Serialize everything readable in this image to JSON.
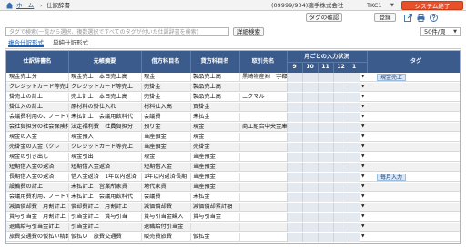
{
  "breadcrumb": {
    "home": "ホーム",
    "separator": "›",
    "current": "仕訳辞書"
  },
  "user_info": "(09999/904)糖手株式会社",
  "company_selector": {
    "label": "TKC1",
    "caret": "▼"
  },
  "exit_button": "システム終了",
  "toolbar": {
    "tag_confirm": "タグの確認",
    "register": "登録"
  },
  "icons": [
    "export-icon",
    "print-icon",
    "help-icon",
    "home-icon"
  ],
  "search": {
    "placeholder": "タグで検索(一覧から選択、複数選択ですべてのタグが付いた仕訳辞書を検索)",
    "detail_button": "詳細検索"
  },
  "per_page": {
    "value": "50件/頁",
    "caret": "▼"
  },
  "tabs": [
    {
      "label": "複合仕訳形式",
      "active": true
    },
    {
      "label": "単純仕訳形式",
      "active": false
    }
  ],
  "table": {
    "headers": {
      "name": "仕訳辞書名",
      "summary": "元帳摘要",
      "debit": "借方科目名",
      "credit": "貸方科目名",
      "partner": "取引先名",
      "monthly_group": "月ごとの入力状況",
      "months": [
        "9",
        "10",
        "11",
        "12",
        "1"
      ],
      "tag": "タグ"
    },
    "rows": [
      {
        "name": "現金売上分",
        "summary": "現金売上　本日売上高",
        "debit": "現金",
        "credit": "製品売上高",
        "partner": "黒崎物産㈱　宇都宮",
        "tag": "現金売上"
      },
      {
        "name": "クレジットカード等売上",
        "summary": "クレジットカード等売上",
        "debit": "売掛金",
        "credit": "製品売上高",
        "partner": "",
        "tag": ""
      },
      {
        "name": "掛売上の計上",
        "summary": "売上計上　本日売上高",
        "debit": "売掛金",
        "credit": "製品売上高",
        "partner": "ニクマル",
        "tag": ""
      },
      {
        "name": "掛仕入の計上",
        "summary": "原材料の掛仕入れ",
        "debit": "材料仕入高",
        "credit": "買掛金",
        "partner": "",
        "tag": ""
      },
      {
        "name": "会議費利用の、ノートで",
        "summary": "未払計上　会議用飲料代",
        "debit": "会議費",
        "credit": "未払金",
        "partner": "",
        "tag": ""
      },
      {
        "name": "会社負担分の社会保険料",
        "summary": "法定福利費　社員負担分",
        "debit": "預り金",
        "credit": "現金",
        "partner": "商工組合中央金庫",
        "tag": ""
      },
      {
        "name": "現金の入金",
        "summary": "現金預入",
        "debit": "当座預金",
        "credit": "現金",
        "partner": "",
        "tag": ""
      },
      {
        "name": "売掛金の入金（クレ",
        "summary": "クレジットカード等売上",
        "debit": "当座預金",
        "credit": "売掛金",
        "partner": "",
        "tag": ""
      },
      {
        "name": "現金の引き出し",
        "summary": "現金引出",
        "debit": "現金",
        "credit": "当座預金",
        "partner": "",
        "tag": ""
      },
      {
        "name": "短期借入金の返済",
        "summary": "短期借入金返済",
        "debit": "短期借入金",
        "credit": "当座預金",
        "partner": "",
        "tag": ""
      },
      {
        "name": "長期借入金の返済",
        "summary": "借入金返済　1年以内返済",
        "debit": "1年以内返済長期",
        "credit": "当座預金",
        "partner": "",
        "tag": "毎月入力"
      },
      {
        "name": "設備費の計上",
        "summary": "未払計上　営業所家賃",
        "debit": "地代家賃",
        "credit": "当座預金",
        "partner": "",
        "tag": ""
      },
      {
        "name": "会議用費利用、ノートで",
        "summary": "未払計上　会議用飲料代",
        "debit": "会議費",
        "credit": "未払金",
        "partner": "",
        "tag": ""
      },
      {
        "name": "減価償却費　月割計上",
        "summary": "償却費計上　月割計上",
        "debit": "減価償却費",
        "credit": "減価償却累計額",
        "partner": "",
        "tag": ""
      },
      {
        "name": "賞与引当金　月割計上",
        "summary": "引当金計上　賞与引当",
        "debit": "賞与引当金繰入",
        "credit": "賞与引当金",
        "partner": "",
        "tag": ""
      },
      {
        "name": "退職給与引当金計上",
        "summary": "引当金計上",
        "debit": "退職給付引当金",
        "credit": "",
        "partner": "",
        "tag": ""
      },
      {
        "name": "旅費交通費の仮払い精算",
        "summary": "仮払い　旅費交通費",
        "debit": "販売費旅費",
        "credit": "仮払金",
        "partner": "",
        "tag": ""
      }
    ]
  },
  "colors": {
    "header_bg": "#3a5b8c",
    "exit_button_bg": "#e8502a",
    "month_cell_bg": "#e4e8ef",
    "tag_chip_bg": "#d8e8f8",
    "link": "#1a5fb4"
  }
}
